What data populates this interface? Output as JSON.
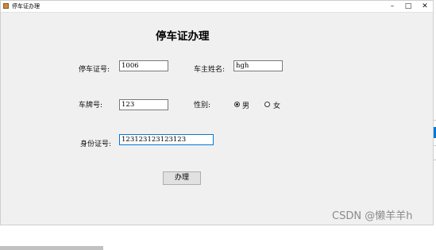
{
  "window": {
    "title": "停车证办理",
    "minimize_glyph": "–",
    "maximize_glyph": "□",
    "close_glyph": "✕"
  },
  "form": {
    "heading": "停车证办理",
    "permit_no": {
      "label": "停车证号:",
      "value": "1006"
    },
    "owner_name": {
      "label": "车主姓名:",
      "value": "hgh"
    },
    "plate_no": {
      "label": "车牌号:",
      "value": "123"
    },
    "gender": {
      "label": "性别:",
      "options": [
        "男",
        "女"
      ],
      "selected": "男"
    },
    "id_no": {
      "label": "身份证号:",
      "value": "123123123123123"
    },
    "submit_label": "办理"
  },
  "watermark": "CSDN @懒羊羊h",
  "colors": {
    "window_bg": "#f0f0f0",
    "focus_border": "#0078d7",
    "button_bg": "#e1e1e1"
  },
  "icons": {
    "app": "app-icon"
  }
}
